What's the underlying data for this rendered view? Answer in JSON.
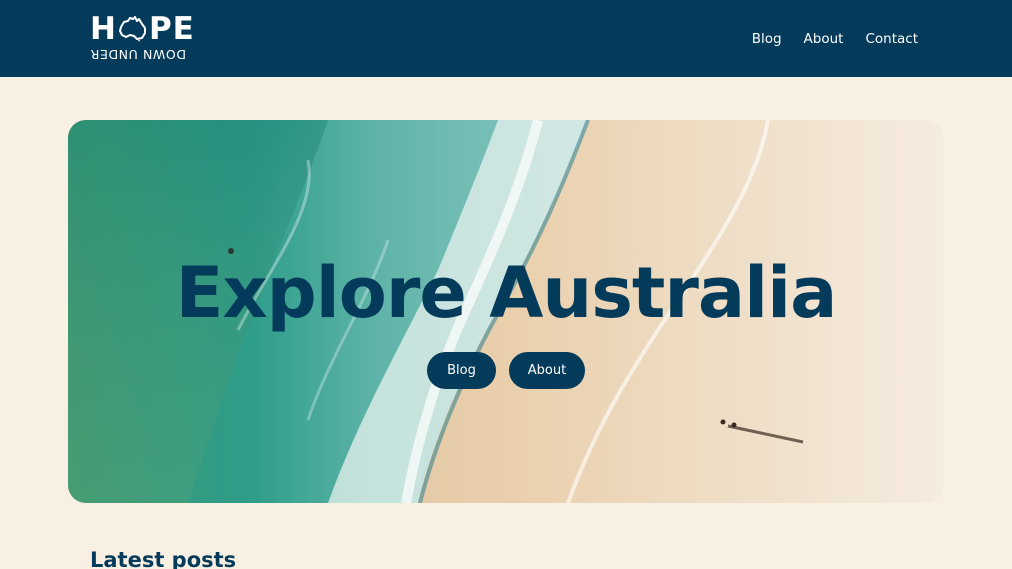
{
  "header": {
    "logo_top_left": "H",
    "logo_top_right": "PE",
    "logo_bottom": "DOWN UNDER",
    "logo_icon": "australia-map-icon",
    "nav": [
      {
        "label": "Blog"
      },
      {
        "label": "About"
      },
      {
        "label": "Contact"
      }
    ]
  },
  "hero": {
    "title": "Explore Australia",
    "buttons": [
      {
        "label": "Blog"
      },
      {
        "label": "About"
      }
    ]
  },
  "latest": {
    "heading": "Latest posts"
  },
  "colors": {
    "navy": "#053b5a",
    "cream": "#f7f0e3",
    "sand": "#e8cfae",
    "ocean": "#2f9a7e"
  }
}
